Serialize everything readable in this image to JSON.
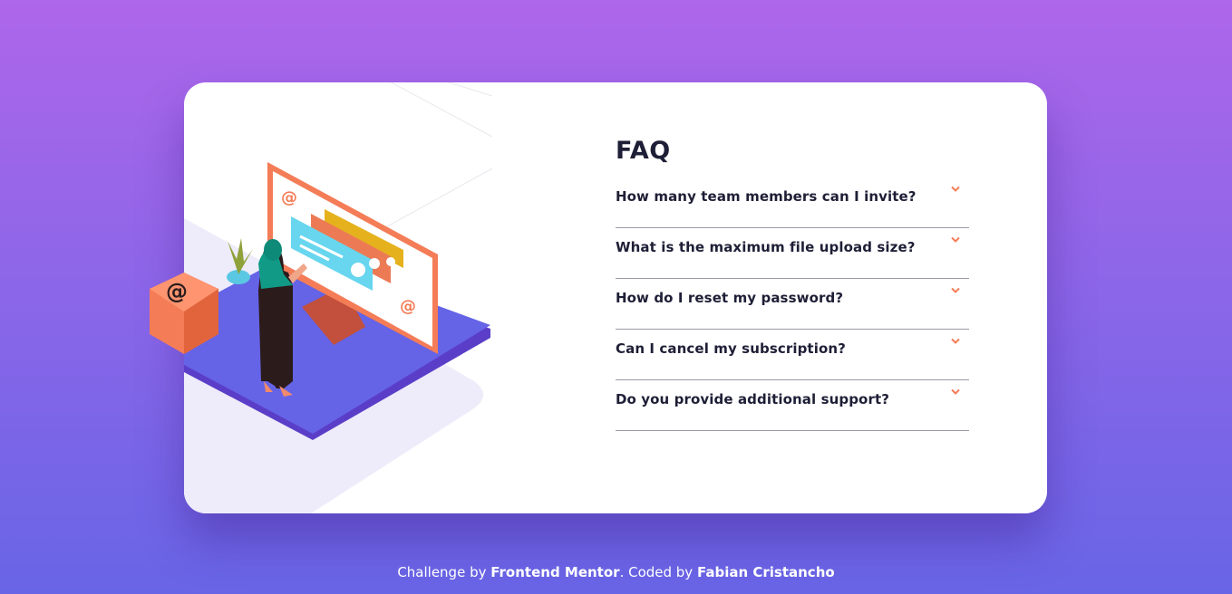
{
  "faq": {
    "title": "FAQ",
    "items": [
      {
        "question": "How many team members can I invite?",
        "icon": "chevron-down-icon"
      },
      {
        "question": "What is the maximum file upload size?",
        "icon": "chevron-down-icon"
      },
      {
        "question": "How do I reset my password?",
        "icon": "chevron-down-icon"
      },
      {
        "question": "Can I cancel my subscription?",
        "icon": "chevron-down-icon"
      },
      {
        "question": "Do you provide additional support?",
        "icon": "chevron-down-icon"
      }
    ]
  },
  "footer": {
    "prefix": "Challenge by ",
    "brand": "Frontend Mentor",
    "middle": ". Coded by ",
    "author": "Fabian Cristancho"
  },
  "colors": {
    "accent": "#f47c57",
    "text": "#1e1f36",
    "divider": "#9b9ba6",
    "bg_top": "#ae66ea",
    "bg_bottom": "#6865e6"
  }
}
